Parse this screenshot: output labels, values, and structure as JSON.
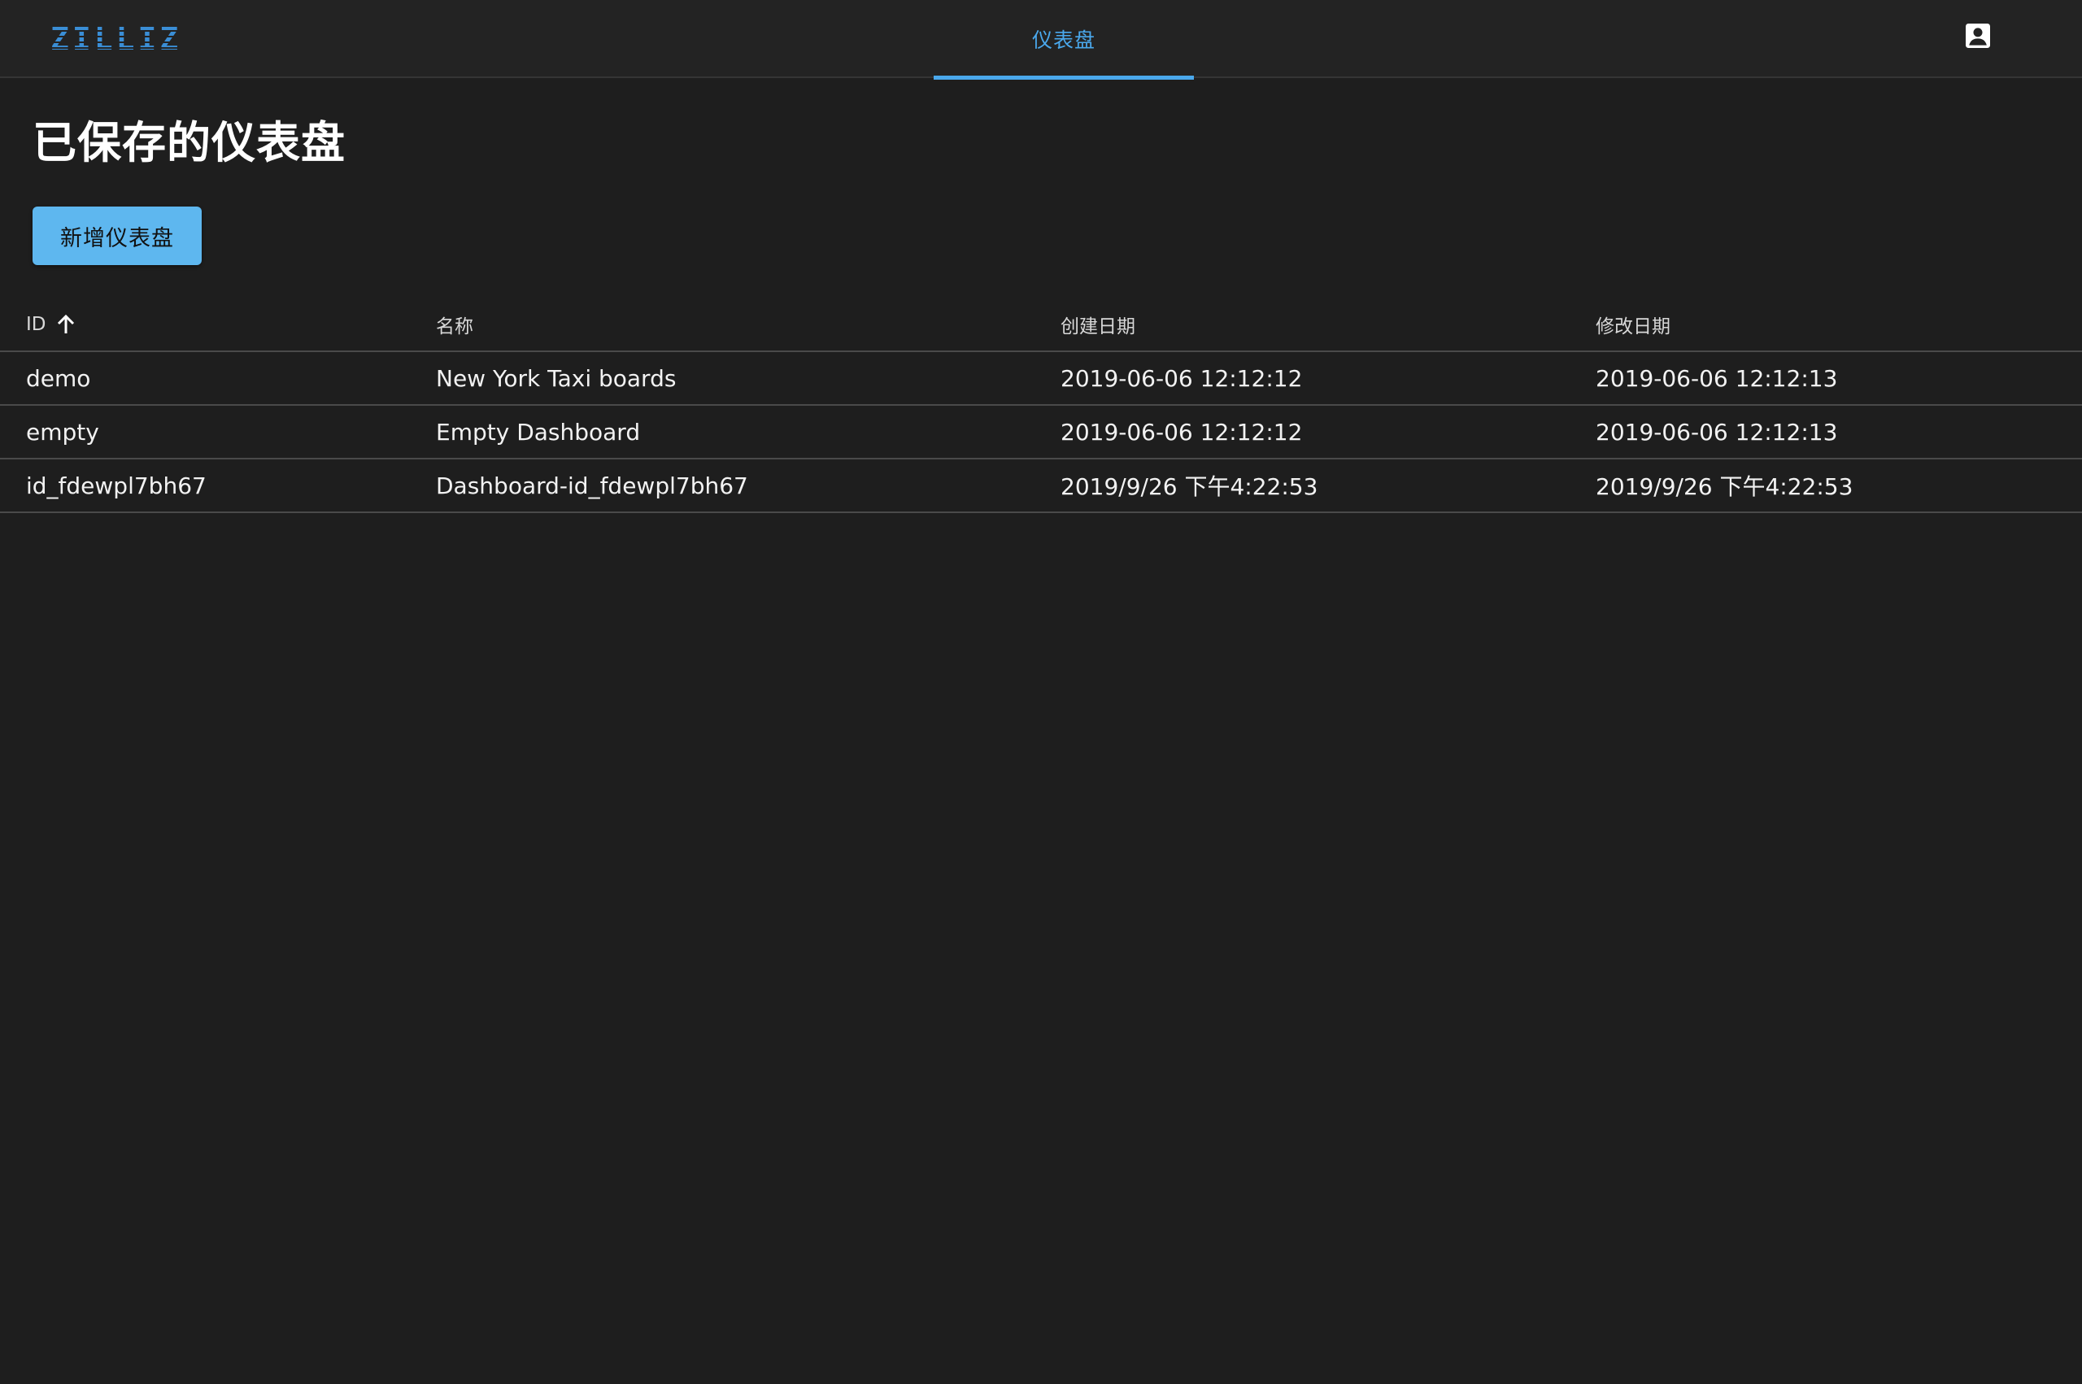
{
  "header": {
    "logo_text": "ZILLIZ",
    "nav_tab_label": "仪表盘",
    "account_icon": "account-box-icon"
  },
  "main": {
    "title": "已保存的仪表盘",
    "add_button_label": "新增仪表盘"
  },
  "table": {
    "columns": [
      "ID",
      "名称",
      "创建日期",
      "修改日期"
    ],
    "sort_icon": "arrow-up-icon",
    "rows": [
      [
        "demo",
        "New York Taxi boards",
        "2019-06-06 12:12:12",
        "2019-06-06 12:12:13"
      ],
      [
        "empty",
        "Empty Dashboard",
        "2019-06-06 12:12:12",
        "2019-06-06 12:12:13"
      ],
      [
        "id_fdewpl7bh67",
        "Dashboard-id_fdewpl7bh67",
        "2019/9/26 下午4:22:53",
        "2019/9/26 下午4:22:53"
      ]
    ]
  },
  "colors": {
    "background": "#1e1e1e",
    "topbar": "#232323",
    "accent": "#4aa8ec",
    "button": "#5eb7ef",
    "logo": "#3a8ed6"
  }
}
